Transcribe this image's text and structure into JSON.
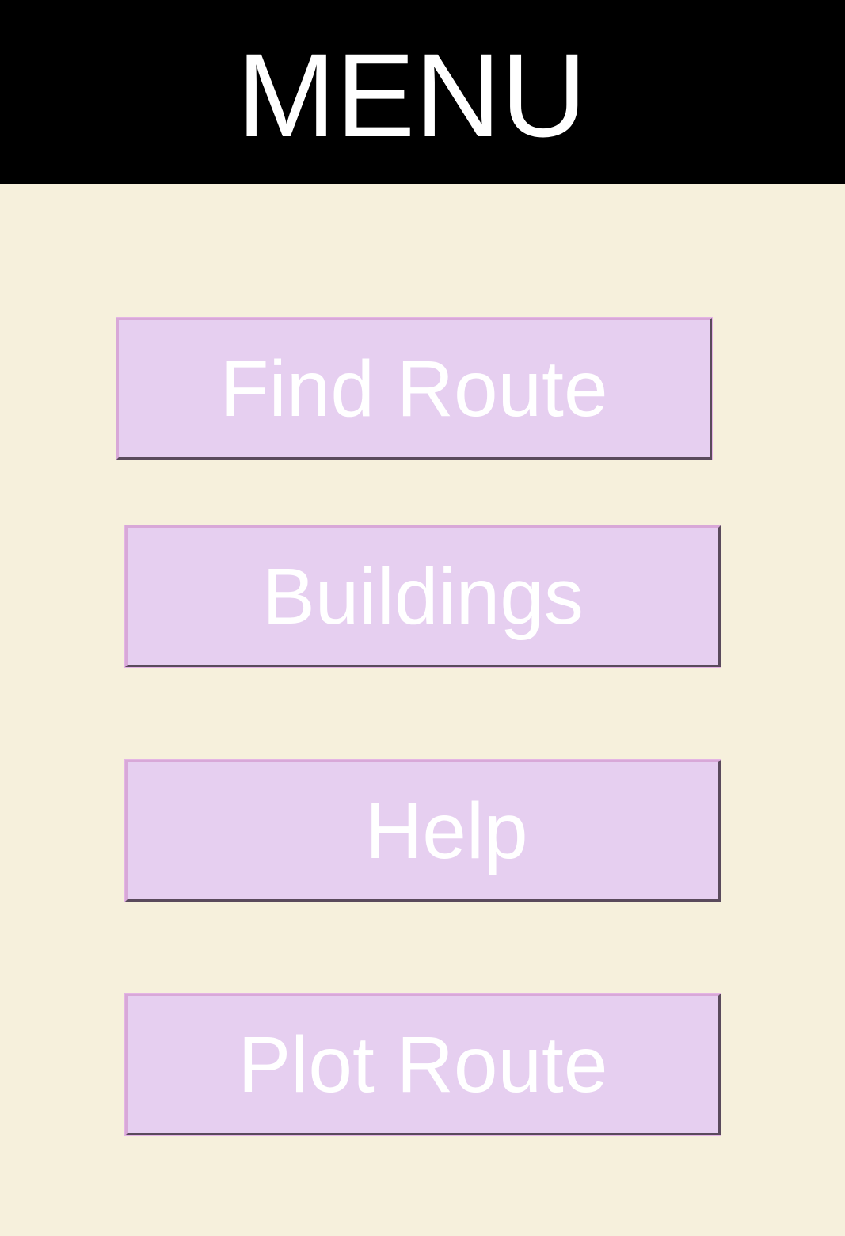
{
  "header": {
    "title": "MENU"
  },
  "menu": {
    "items": [
      {
        "label": "Find Route"
      },
      {
        "label": "Buildings"
      },
      {
        "label": "Help"
      },
      {
        "label": "Plot Route"
      }
    ]
  },
  "colors": {
    "background": "#f6f0dc",
    "header_background": "#000000",
    "button_background": "#e6cff0",
    "text": "#ffffff"
  }
}
